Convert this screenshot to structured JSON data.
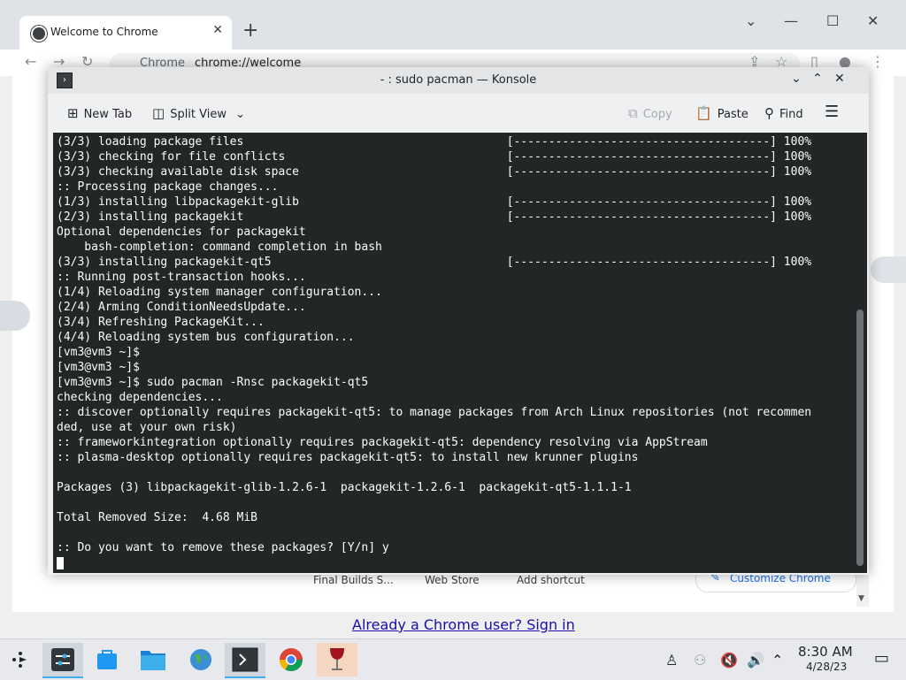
{
  "chrome": {
    "tab_title": "Welcome to Chrome",
    "tab_close": "✕",
    "new_tab": "+",
    "omnibox_label": "Chrome",
    "omnibox_url": "chrome://welcome",
    "shortcuts": [
      "Final Builds S...",
      "Web Store",
      "Add shortcut"
    ],
    "customize_label": "Customize Chrome",
    "signin_link": "Already a Chrome user? Sign in"
  },
  "konsole": {
    "title": "- : sudo pacman — Konsole",
    "toolbar": {
      "new_tab": "New Tab",
      "split_view": "Split View",
      "copy": "Copy",
      "paste": "Paste",
      "find": "Find"
    },
    "terminal_lines": [
      "(3/3) loading package files                                      [-------------------------------------] 100%",
      "(3/3) checking for file conflicts                                [-------------------------------------] 100%",
      "(3/3) checking available disk space                              [-------------------------------------] 100%",
      ":: Processing package changes...",
      "(1/3) installing libpackagekit-glib                              [-------------------------------------] 100%",
      "(2/3) installing packagekit                                      [-------------------------------------] 100%",
      "Optional dependencies for packagekit",
      "    bash-completion: command completion in bash",
      "(3/3) installing packagekit-qt5                                  [-------------------------------------] 100%",
      ":: Running post-transaction hooks...",
      "(1/4) Reloading system manager configuration...",
      "(2/4) Arming ConditionNeedsUpdate...",
      "(3/4) Refreshing PackageKit...",
      "(4/4) Reloading system bus configuration...",
      "[vm3@vm3 ~]$",
      "[vm3@vm3 ~]$",
      "[vm3@vm3 ~]$ sudo pacman -Rnsc packagekit-qt5",
      "checking dependencies...",
      ":: discover optionally requires packagekit-qt5: to manage packages from Arch Linux repositories (not recommen",
      "ded, use at your own risk)",
      ":: frameworkintegration optionally requires packagekit-qt5: dependency resolving via AppStream",
      ":: plasma-desktop optionally requires packagekit-qt5: to install new krunner plugins",
      "",
      "Packages (3) libpackagekit-glib-1.2.6-1  packagekit-1.2.6-1  packagekit-qt5-1.1.1-1",
      "",
      "Total Removed Size:  4.68 MiB",
      "",
      ":: Do you want to remove these packages? [Y/n] y"
    ]
  },
  "taskbar": {
    "time": "8:30 AM",
    "date": "4/28/23"
  }
}
